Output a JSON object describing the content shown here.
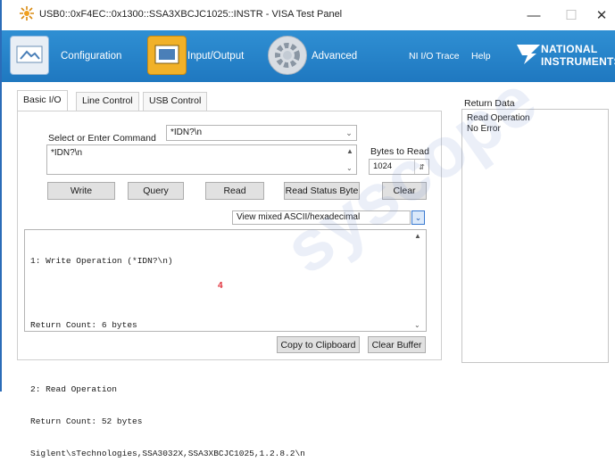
{
  "window": {
    "title": "USB0::0xF4EC::0x1300::SSA3XBCJC1025::INSTR - VISA Test Panel"
  },
  "ribbon": {
    "configuration": "Configuration",
    "input_output": "Input/Output",
    "advanced": "Advanced",
    "ni_io_trace": "NI I/O Trace",
    "help": "Help",
    "logo_line1": "NATIONAL",
    "logo_line2": "INSTRUMENTS"
  },
  "tabs": [
    "Basic I/O",
    "Line Control",
    "USB Control"
  ],
  "command": {
    "label": "Select or Enter Command",
    "selected": "*IDN?\\n",
    "text": "*IDN?\\n"
  },
  "bytes_to_read": {
    "label": "Bytes to Read",
    "value": "1024"
  },
  "buttons": {
    "write": "Write",
    "query": "Query",
    "read": "Read",
    "read_status_byte": "Read Status Byte",
    "clear": "Clear",
    "copy_to_clipboard": "Copy to Clipboard",
    "clear_buffer": "Clear Buffer"
  },
  "view_mode": "View mixed ASCII/hexadecimal",
  "output_lines": [
    "1: Write Operation (*IDN?\\n)",
    "",
    "Return Count: 6 bytes",
    "",
    "2: Read Operation",
    "Return Count: 52 bytes",
    "Siglent\\sTechnologies,SSA3032X,SSA3XBCJC1025,1.2.8.2\\n"
  ],
  "annotation_mark": "4",
  "return_data": {
    "label": "Return Data",
    "lines": [
      "Read Operation",
      "No Error"
    ]
  },
  "watermark": "syscope",
  "colors": {
    "ribbon": "#2585c9",
    "active_tab_icon": "#f1b128"
  }
}
